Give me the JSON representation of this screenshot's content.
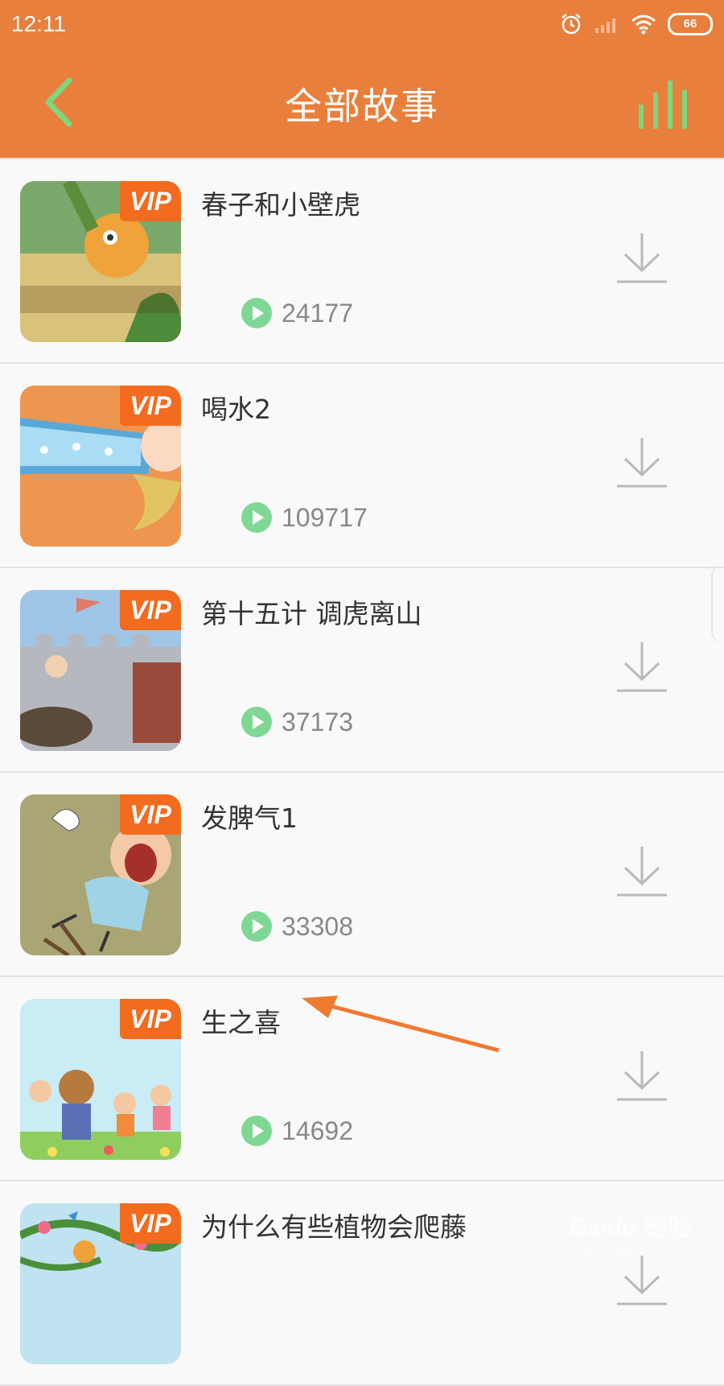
{
  "status_bar": {
    "time": "12:11",
    "battery": "66"
  },
  "header": {
    "title": "全部故事",
    "back_icon": "chevron-left-icon",
    "player_icon": "equalizer-bars-icon",
    "accent": "#e97f3c",
    "icon_color": "#7ed67f"
  },
  "vip_label": "VIP",
  "stories": [
    {
      "title": "春子和小壁虎",
      "plays": "24177"
    },
    {
      "title": "喝水2",
      "plays": "109717"
    },
    {
      "title": "第十五计 调虎离山",
      "plays": "37173"
    },
    {
      "title": "发脾气1",
      "plays": "33308"
    },
    {
      "title": "生之喜",
      "plays": "14692"
    },
    {
      "title": "为什么有些植物会爬藤",
      "plays": ""
    }
  ],
  "watermark": {
    "brand": "Baidu 经验",
    "url": "jingyan.baidu.com"
  }
}
